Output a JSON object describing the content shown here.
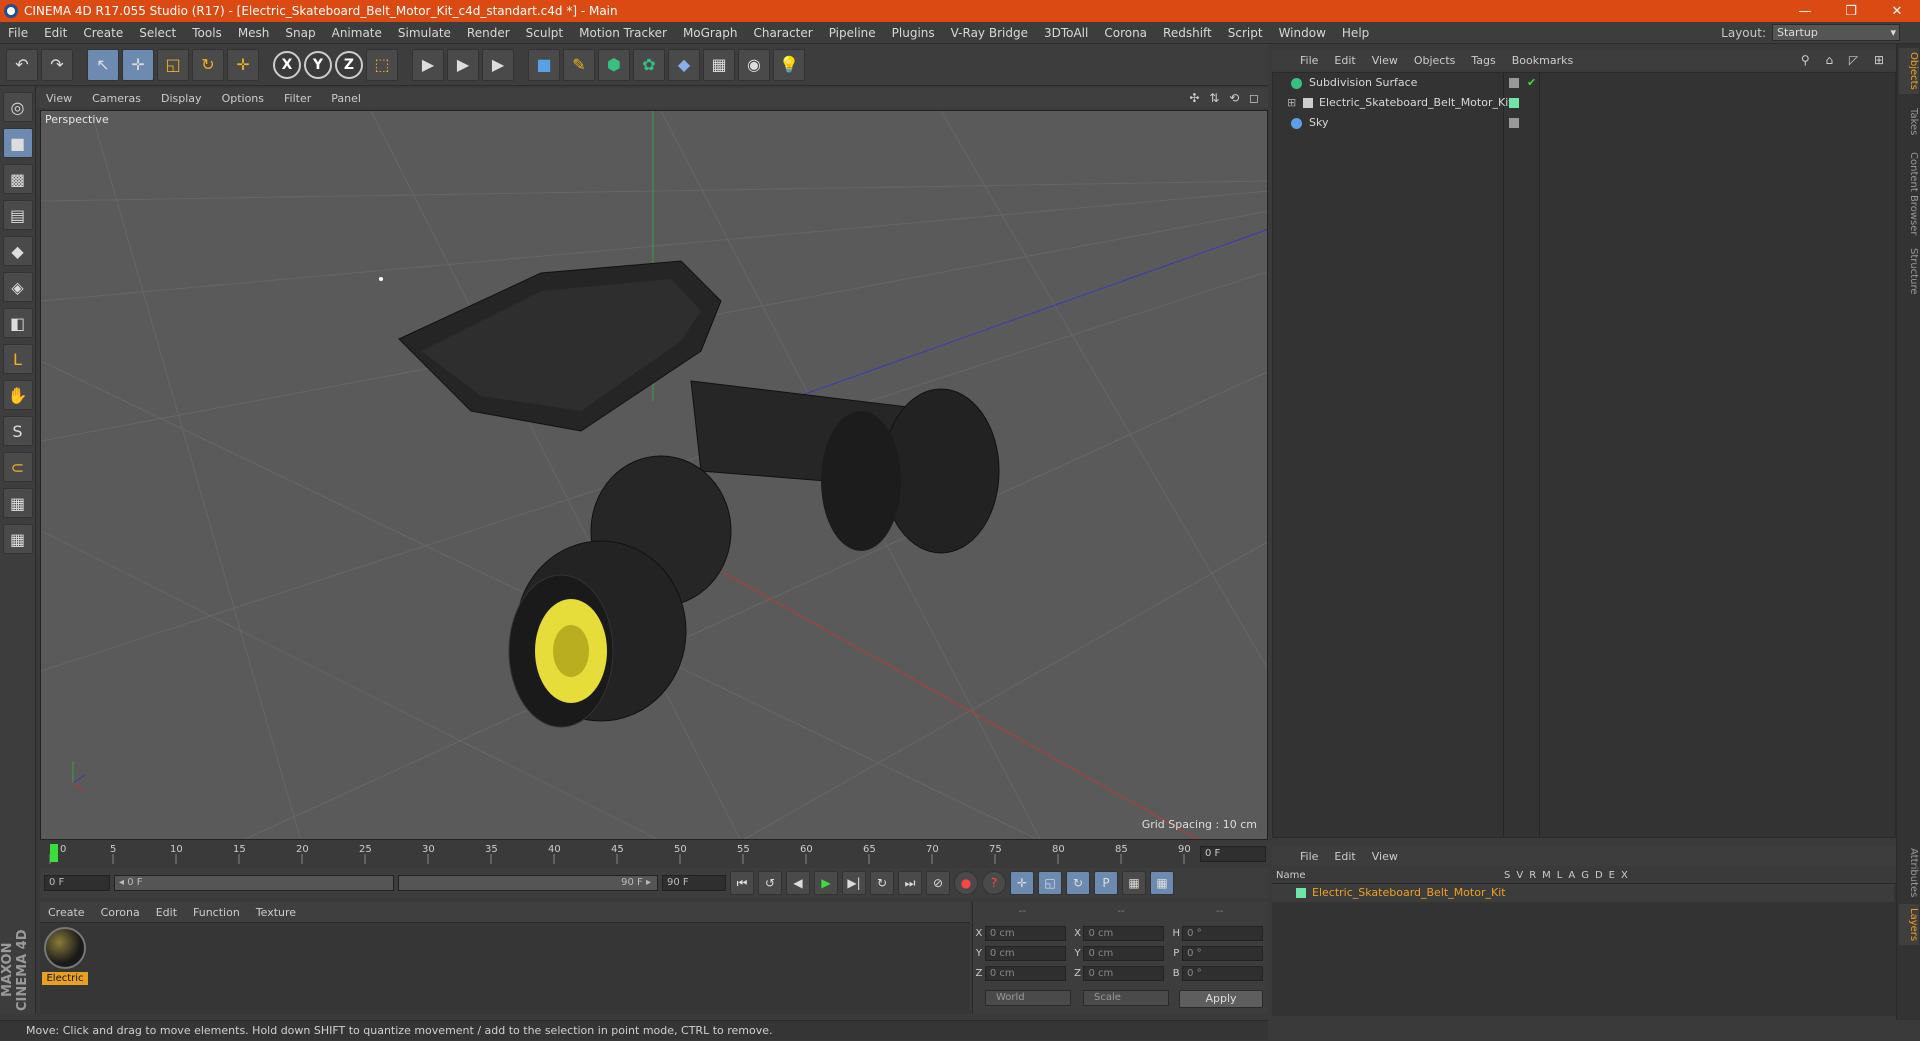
{
  "window": {
    "title": "CINEMA 4D R17.055 Studio (R17) - [Electric_Skateboard_Belt_Motor_Kit_c4d_standart.c4d *] - Main",
    "controls": [
      "—",
      "❐",
      "✕"
    ]
  },
  "menubar": {
    "items": [
      "File",
      "Edit",
      "Create",
      "Select",
      "Tools",
      "Mesh",
      "Snap",
      "Animate",
      "Simulate",
      "Render",
      "Sculpt",
      "Motion Tracker",
      "MoGraph",
      "Character",
      "Pipeline",
      "Plugins",
      "V-Ray Bridge",
      "3DToAll",
      "Corona",
      "Redshift",
      "Script",
      "Window",
      "Help"
    ],
    "layout_label": "Layout:",
    "layout_value": "Startup"
  },
  "toolbar": {
    "undo": "↶",
    "redo": "↷",
    "select": "↖",
    "move": "✛",
    "scale": "◱",
    "rotate": "↻",
    "last": "✛",
    "axis_x": "X",
    "axis_y": "Y",
    "axis_z": "Z",
    "coord": "⬚",
    "render1": "▶",
    "render2": "▶",
    "render3": "▶",
    "cube": "■",
    "pen": "✎",
    "subdiv": "⬢",
    "clone": "✿",
    "deform": "◆",
    "floor": "▦",
    "camera": "◉",
    "light": "💡"
  },
  "lefttools": [
    "◎",
    "■",
    "▩",
    "▤",
    "◆",
    "◈",
    "◧",
    "L",
    "✋",
    "S",
    "⊂",
    "▦",
    "▦"
  ],
  "viewport": {
    "menu": [
      "View",
      "Cameras",
      "Display",
      "Options",
      "Filter",
      "Panel"
    ],
    "nav_icons": "✣ ⇅ ⟲ ◻",
    "label": "Perspective",
    "grid_spacing": "Grid Spacing : 10 cm"
  },
  "timeline": {
    "ticks": [
      "0",
      "5",
      "10",
      "15",
      "20",
      "25",
      "30",
      "35",
      "40",
      "45",
      "50",
      "55",
      "60",
      "65",
      "70",
      "75",
      "80",
      "85",
      "90"
    ],
    "current_frame": "0 F"
  },
  "transport": {
    "start_field": "0 F",
    "range_start": "◂ 0 F",
    "range_end": "90 F ▸",
    "end_field": "90 F",
    "buttons": [
      "⏮",
      "↺",
      "◀",
      "▶",
      "▶|",
      "↻",
      "⏭"
    ],
    "keys": [
      "⊘",
      "●",
      "?",
      "✛",
      "◱",
      "↻",
      "P",
      "▦",
      "▦"
    ]
  },
  "material": {
    "menu": [
      "Create",
      "Corona",
      "Edit",
      "Function",
      "Texture"
    ],
    "swatch_label": "Electric"
  },
  "coordinates": {
    "head": [
      "--",
      "--",
      "--"
    ],
    "rows": [
      {
        "a": "X",
        "v1": "0 cm",
        "b": "X",
        "v2": "0 cm",
        "c": "H",
        "v3": "0 °"
      },
      {
        "a": "Y",
        "v1": "0 cm",
        "b": "Y",
        "v2": "0 cm",
        "c": "P",
        "v3": "0 °"
      },
      {
        "a": "Z",
        "v1": "0 cm",
        "b": "Z",
        "v2": "0 cm",
        "c": "B",
        "v3": "0 °"
      }
    ],
    "mode": "World",
    "type": "Scale",
    "apply": "Apply"
  },
  "status": "Move: Click and drag to move elements. Hold down SHIFT to quantize movement / add to the selection in point mode, CTRL to remove.",
  "objects": {
    "menu": [
      "File",
      "Edit",
      "View",
      "Objects",
      "Tags",
      "Bookmarks"
    ],
    "tools": "⚲ ⌂ ◸ ⊞",
    "items": [
      {
        "name": "Subdivision Surface"
      },
      {
        "name": "Electric_Skateboard_Belt_Motor_Kit"
      },
      {
        "name": "Sky"
      }
    ]
  },
  "layers": {
    "menu": [
      "File",
      "Edit",
      "View"
    ],
    "head_name": "Name",
    "columns": [
      "S",
      "V",
      "R",
      "M",
      "L",
      "A",
      "G",
      "D",
      "E",
      "X"
    ],
    "row_name": "Electric_Skateboard_Belt_Motor_Kit"
  },
  "right_tabs": [
    "Objects",
    "Takes",
    "Content Browser",
    "Structure",
    "Attributes",
    "Layers"
  ],
  "maxon": "MAXON CINEMA 4D",
  "colors": {
    "title_bg": "#dc4a14",
    "accent": "#f0a020",
    "viewport_bg": "#5a5a5a"
  }
}
